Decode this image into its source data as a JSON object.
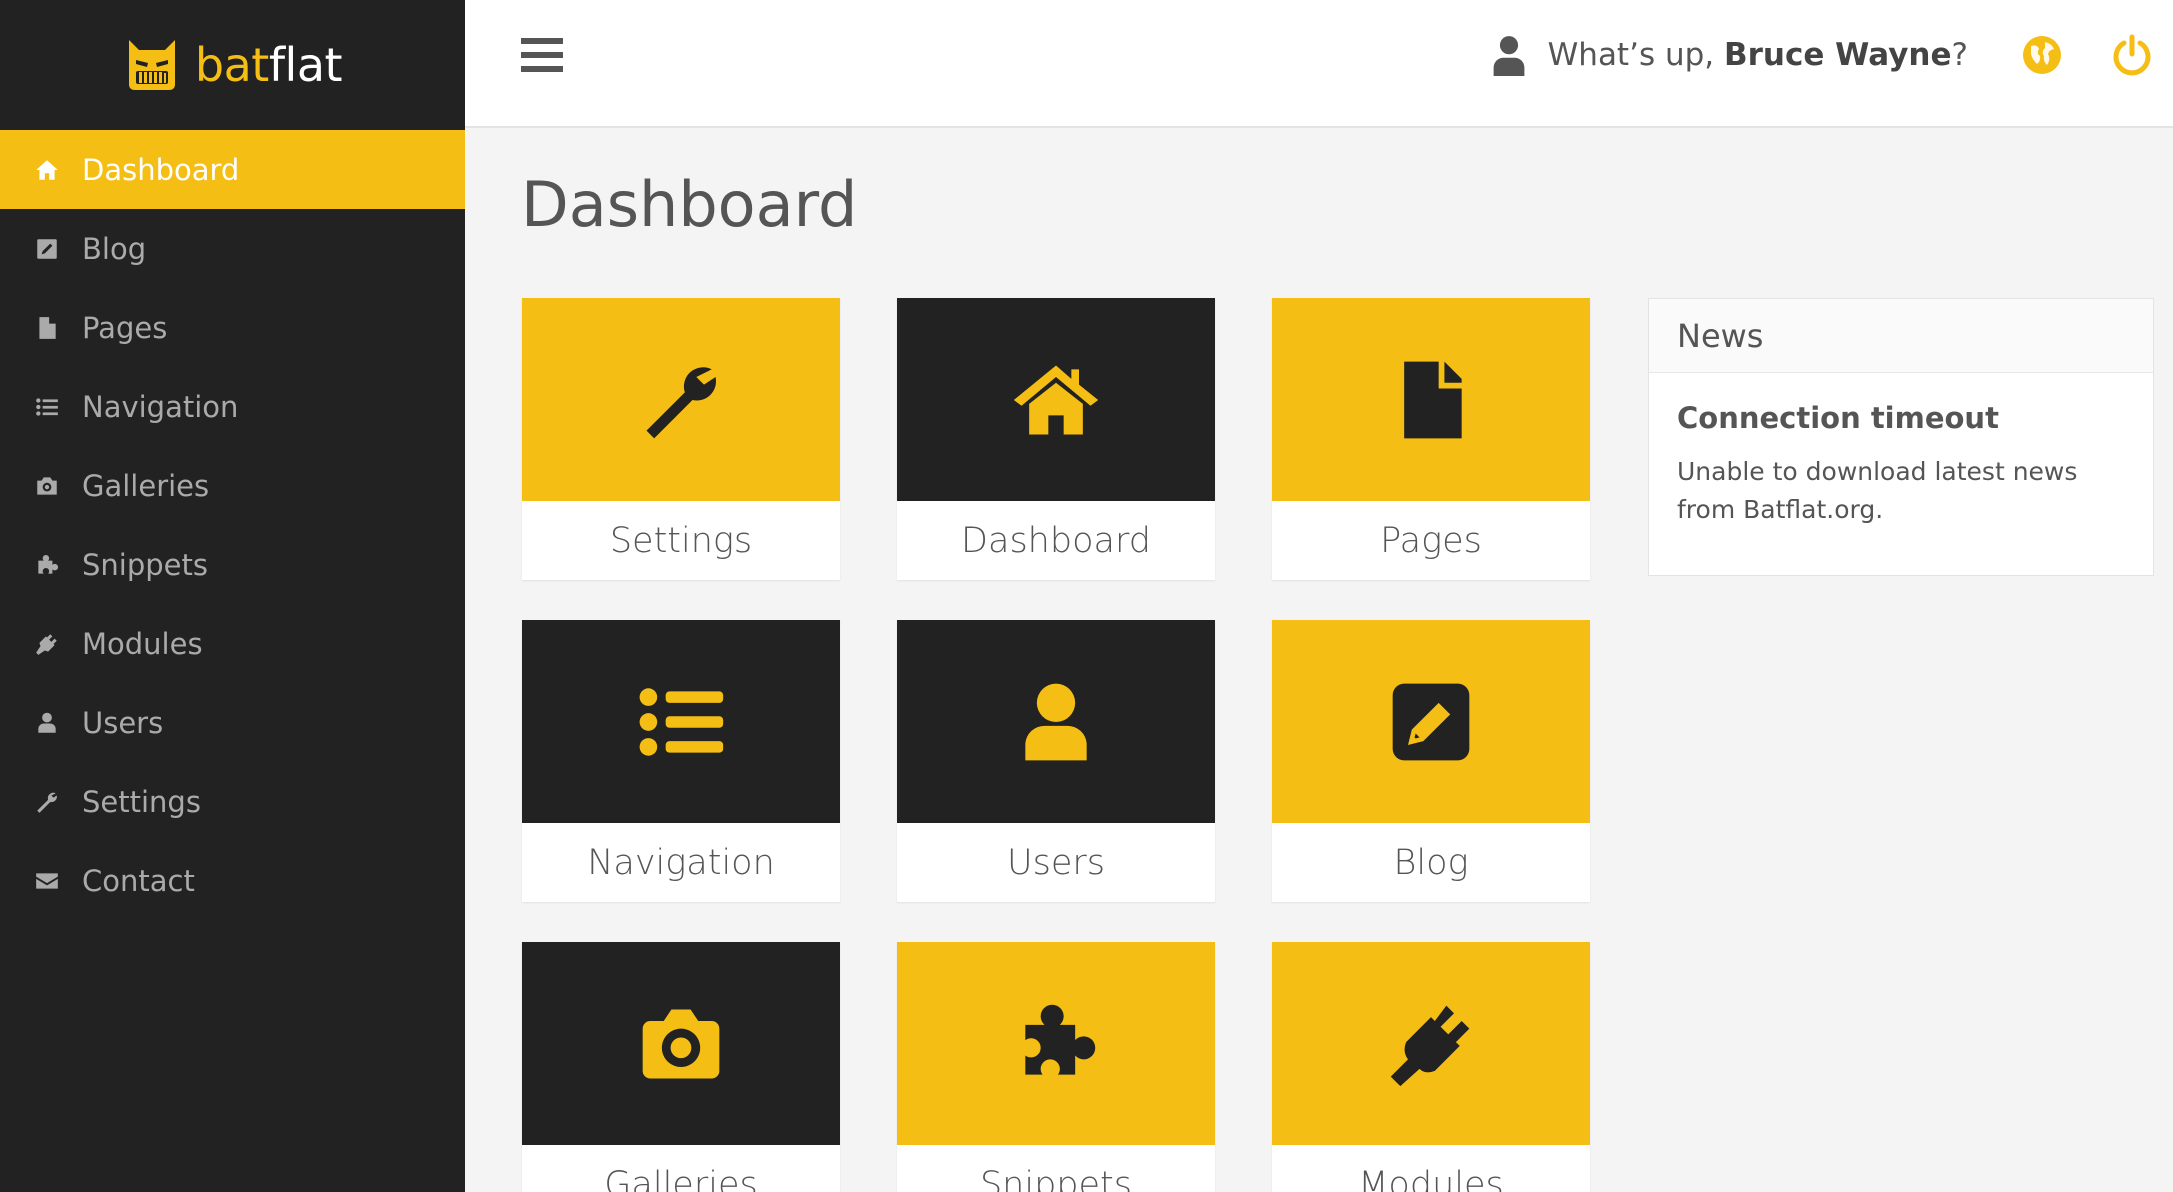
{
  "brand": {
    "part1": "bat",
    "part2": "flat",
    "logo_icon": "bat-mascot-icon"
  },
  "sidebar": {
    "items": [
      {
        "label": "Dashboard",
        "icon": "home-icon",
        "active": true
      },
      {
        "label": "Blog",
        "icon": "edit-icon"
      },
      {
        "label": "Pages",
        "icon": "file-icon"
      },
      {
        "label": "Navigation",
        "icon": "list-icon"
      },
      {
        "label": "Galleries",
        "icon": "camera-icon"
      },
      {
        "label": "Snippets",
        "icon": "puzzle-icon"
      },
      {
        "label": "Modules",
        "icon": "plug-icon"
      },
      {
        "label": "Users",
        "icon": "user-icon"
      },
      {
        "label": "Settings",
        "icon": "wrench-icon"
      },
      {
        "label": "Contact",
        "icon": "envelope-icon"
      }
    ]
  },
  "header": {
    "greeting_prefix": "What’s up, ",
    "user_name": "Bruce Wayne",
    "greeting_suffix": "?",
    "globe_icon": "globe-icon",
    "power_icon": "power-icon"
  },
  "main": {
    "title": "Dashboard",
    "tiles": [
      {
        "label": "Settings",
        "icon": "wrench-icon",
        "color": "yellow"
      },
      {
        "label": "Dashboard",
        "icon": "home-icon",
        "color": "dark"
      },
      {
        "label": "Pages",
        "icon": "file-icon",
        "color": "yellow"
      },
      {
        "label": "Navigation",
        "icon": "list-icon",
        "color": "dark"
      },
      {
        "label": "Users",
        "icon": "user-icon",
        "color": "dark"
      },
      {
        "label": "Blog",
        "icon": "edit-icon",
        "color": "yellow"
      },
      {
        "label": "Galleries",
        "icon": "camera-icon",
        "color": "dark"
      },
      {
        "label": "Snippets",
        "icon": "puzzle-icon",
        "color": "yellow"
      },
      {
        "label": "Modules",
        "icon": "plug-icon",
        "color": "yellow"
      }
    ]
  },
  "news": {
    "heading": "News",
    "title": "Connection timeout",
    "text": "Unable to download latest news from Batflat.org."
  },
  "colors": {
    "accent": "#f5be14",
    "dark": "#222222",
    "background": "#f4f4f4"
  }
}
